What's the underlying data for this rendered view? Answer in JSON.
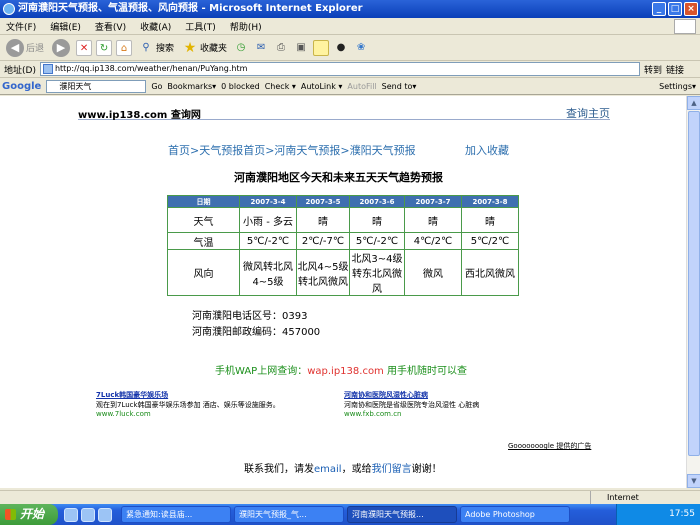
{
  "window": {
    "title": "河南濮阳天气预报、气温预报、风向预报 - Microsoft Internet Explorer"
  },
  "menu": [
    "文件(F)",
    "编辑(E)",
    "查看(V)",
    "收藏(A)",
    "工具(T)",
    "帮助(H)"
  ],
  "toolbar": {
    "back": "后退",
    "search": "搜索",
    "favorites": "收藏夹"
  },
  "address": {
    "label": "地址(D)",
    "url": "http://qq.ip138.com/weather/henan/PuYang.htm",
    "go": "转到",
    "links": "链接"
  },
  "googlebar": {
    "logo": "Google",
    "query": "濮阳天气",
    "go": "Go",
    "bookmarks": "Bookmarks▾",
    "blocked": "0 blocked",
    "check": "Check ▾",
    "autolink": "AutoLink ▾",
    "autofill": "AutoFill",
    "sendto": "Send to▾",
    "settings": "Settings▾"
  },
  "page": {
    "site": "www.ip138.com 查询网",
    "home": "查询主页",
    "nav": "首页>天气预报首页>河南天气预报>濮阳天气预报",
    "fav": "加入收藏",
    "heading": "河南濮阳地区今天和未来五天天气趋势预报",
    "table": {
      "headers": [
        "日期",
        "2007-3-4",
        "2007-3-5",
        "2007-3-6",
        "2007-3-7",
        "2007-3-8"
      ],
      "rows": [
        [
          "天气",
          "小雨 - 多云",
          "晴",
          "晴",
          "晴",
          "晴"
        ],
        [
          "气温",
          "5℃/-2℃",
          "2℃/-7℃",
          "5℃/-2℃",
          "4℃/2℃",
          "5℃/2℃"
        ],
        [
          "风向",
          "微风转北风4~5级",
          "北风4~5级转北风微风",
          "北风3~4级转东北风微风",
          "微风",
          "西北风微风"
        ]
      ]
    },
    "phone": "河南濮阳电话区号：0393",
    "postcode": "河南濮阳邮政编码：457000",
    "wap_prefix": "手机WAP上网查询：",
    "wap_url": "wap.ip138.com",
    "wap_suffix": " 用手机随时可以查",
    "ads": [
      {
        "title": "7Luck韩国豪华娱乐场",
        "desc": "观在到7Luck韩国豪华娱乐场参加 酒店、娱乐等设施服务。",
        "url": "www.7luck.com"
      },
      {
        "title": "河南协和医院风湿性心脏病",
        "desc": "河南协和医院是省级医院专治风湿性 心脏病",
        "url": "www.fxb.com.cn"
      }
    ],
    "google_ads": "Gooooooogle 提供的广告",
    "contact_a": "联系我们，请发",
    "contact_email": "email",
    "contact_b": "，或给",
    "contact_msg": "我们留言",
    "contact_c": "谢谢！"
  },
  "status": {
    "zone": "Internet"
  },
  "taskbar": {
    "start": "开始",
    "tasks": [
      "紧急通知:读县庙...",
      "濮阳天气预报_气...",
      "河南濮阳天气预报...",
      "Adobe Photoshop"
    ],
    "clock": "17:55"
  },
  "colors": {
    "header_bg": "#3f6fb0",
    "border": "#4a9a4a",
    "link": "#2d6fae"
  }
}
